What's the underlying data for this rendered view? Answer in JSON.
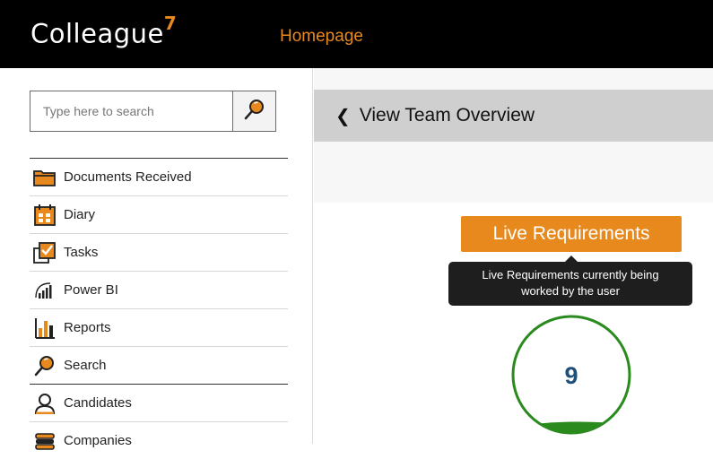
{
  "header": {
    "logo_text": "Colleague",
    "logo_superscript": "7",
    "page_title": "Homepage"
  },
  "search": {
    "placeholder": "Type here to search",
    "button_icon": "search-icon"
  },
  "sidebar": {
    "items": [
      {
        "label": "Documents Received",
        "icon": "folder-icon"
      },
      {
        "label": "Diary",
        "icon": "calendar-icon"
      },
      {
        "label": "Tasks",
        "icon": "tasks-checkbox-icon"
      },
      {
        "label": "Power BI",
        "icon": "power-bi-icon"
      },
      {
        "label": "Reports",
        "icon": "bar-chart-icon"
      },
      {
        "label": "Search",
        "icon": "search-icon"
      },
      {
        "label": "Candidates",
        "icon": "person-icon"
      },
      {
        "label": "Companies",
        "icon": "companies-stack-icon"
      }
    ]
  },
  "main": {
    "back_label": "View Team Overview",
    "widget": {
      "badge_label": "Live Requirements",
      "tooltip": [
        "Live Requirements currently being",
        "worked by the user"
      ],
      "value": "9"
    }
  },
  "colors": {
    "accent": "#e8891e",
    "gauge_ring": "#2a8a1e",
    "value_text": "#1f4e79",
    "topbar": "#000000"
  }
}
